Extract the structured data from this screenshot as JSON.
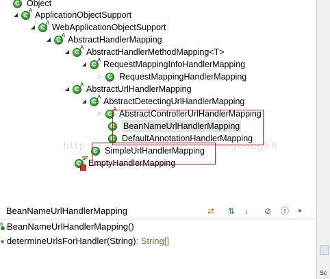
{
  "tree": {
    "nodes": [
      {
        "label": "Object",
        "twisty": "",
        "badge": ""
      },
      {
        "label": "ApplicationObjectSupport",
        "twisty": "◢",
        "badge": "A"
      },
      {
        "label": "WebApplicationObjectSupport",
        "twisty": "◢",
        "badge": "A"
      },
      {
        "label": "AbstractHandlerMapping",
        "twisty": "◢",
        "badge": "A"
      },
      {
        "label": "AbstractHandlerMethodMapping<T>",
        "twisty": "◢",
        "badge": "A"
      },
      {
        "label": "RequestMappingInfoHandlerMapping",
        "twisty": "◢",
        "badge": "A"
      },
      {
        "label": "RequestMappingHandlerMapping",
        "twisty": "▷",
        "badge": ""
      },
      {
        "label": "AbstractUrlHandlerMapping",
        "twisty": "◢",
        "badge": "A"
      },
      {
        "label": "AbstractDetectingUrlHandlerMapping",
        "twisty": "◢",
        "badge": "A"
      },
      {
        "label": "AbstractControllerUrlHandlerMapping",
        "twisty": "▷",
        "badge": "A"
      },
      {
        "label": "BeanNameUrlHandlerMapping",
        "twisty": "",
        "badge": ""
      },
      {
        "label": "DefaultAnnotationHandlerMapping",
        "twisty": "",
        "badge": ""
      },
      {
        "label": "SimpleUrlHandlerMapping",
        "twisty": "",
        "badge": ""
      },
      {
        "label": "EmptyHandlerMapping",
        "twisty": "",
        "badge": "SF"
      }
    ],
    "class_icon_letter": "C"
  },
  "watermark": {
    "left": "http",
    "right": "ongcong68"
  },
  "members_panel": {
    "title": "BeanNameUrlHandlerMapping",
    "toolbar": [
      {
        "name": "lock-view-icon",
        "glyph": "⇄"
      },
      {
        "name": "show-hierarchy-icon",
        "glyph": "⇅"
      },
      {
        "name": "sort-icon",
        "glyph": "↓"
      },
      {
        "name": "hide-fields-icon",
        "glyph": "⊘"
      },
      {
        "name": "hide-static-icon",
        "glyph": "ⓢ"
      },
      {
        "name": "hide-nonpublic-icon",
        "glyph": "●"
      }
    ],
    "members": [
      {
        "name": "BeanNameUrlHandlerMapping()",
        "return_type": "",
        "marker": "c"
      },
      {
        "name": "determineUrlsForHandler(String)",
        "return_type": " : String[]",
        "marker": ""
      }
    ]
  },
  "right_strip": {
    "label": "Sc"
  },
  "colors": {
    "class_icon_green": "#33a333",
    "highlight_red": "#d11c1c"
  }
}
